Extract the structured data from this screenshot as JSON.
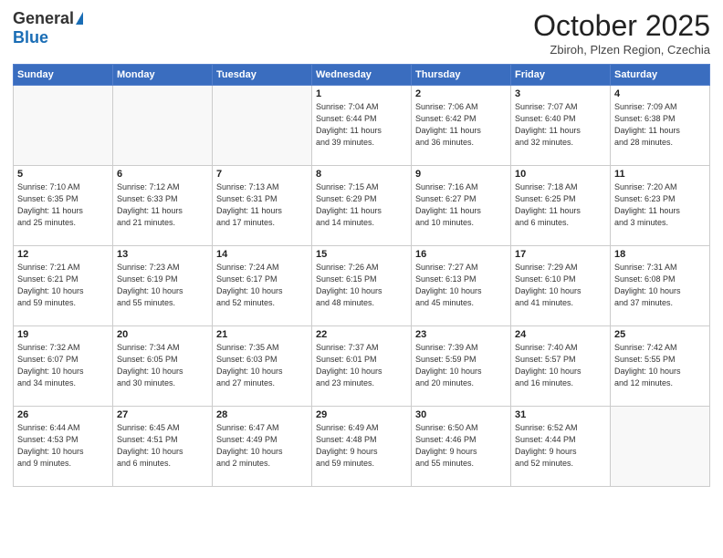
{
  "logo": {
    "general": "General",
    "blue": "Blue"
  },
  "header": {
    "month": "October 2025",
    "location": "Zbiroh, Plzen Region, Czechia"
  },
  "weekdays": [
    "Sunday",
    "Monday",
    "Tuesday",
    "Wednesday",
    "Thursday",
    "Friday",
    "Saturday"
  ],
  "weeks": [
    [
      {
        "day": "",
        "info": ""
      },
      {
        "day": "",
        "info": ""
      },
      {
        "day": "",
        "info": ""
      },
      {
        "day": "1",
        "info": "Sunrise: 7:04 AM\nSunset: 6:44 PM\nDaylight: 11 hours\nand 39 minutes."
      },
      {
        "day": "2",
        "info": "Sunrise: 7:06 AM\nSunset: 6:42 PM\nDaylight: 11 hours\nand 36 minutes."
      },
      {
        "day": "3",
        "info": "Sunrise: 7:07 AM\nSunset: 6:40 PM\nDaylight: 11 hours\nand 32 minutes."
      },
      {
        "day": "4",
        "info": "Sunrise: 7:09 AM\nSunset: 6:38 PM\nDaylight: 11 hours\nand 28 minutes."
      }
    ],
    [
      {
        "day": "5",
        "info": "Sunrise: 7:10 AM\nSunset: 6:35 PM\nDaylight: 11 hours\nand 25 minutes."
      },
      {
        "day": "6",
        "info": "Sunrise: 7:12 AM\nSunset: 6:33 PM\nDaylight: 11 hours\nand 21 minutes."
      },
      {
        "day": "7",
        "info": "Sunrise: 7:13 AM\nSunset: 6:31 PM\nDaylight: 11 hours\nand 17 minutes."
      },
      {
        "day": "8",
        "info": "Sunrise: 7:15 AM\nSunset: 6:29 PM\nDaylight: 11 hours\nand 14 minutes."
      },
      {
        "day": "9",
        "info": "Sunrise: 7:16 AM\nSunset: 6:27 PM\nDaylight: 11 hours\nand 10 minutes."
      },
      {
        "day": "10",
        "info": "Sunrise: 7:18 AM\nSunset: 6:25 PM\nDaylight: 11 hours\nand 6 minutes."
      },
      {
        "day": "11",
        "info": "Sunrise: 7:20 AM\nSunset: 6:23 PM\nDaylight: 11 hours\nand 3 minutes."
      }
    ],
    [
      {
        "day": "12",
        "info": "Sunrise: 7:21 AM\nSunset: 6:21 PM\nDaylight: 10 hours\nand 59 minutes."
      },
      {
        "day": "13",
        "info": "Sunrise: 7:23 AM\nSunset: 6:19 PM\nDaylight: 10 hours\nand 55 minutes."
      },
      {
        "day": "14",
        "info": "Sunrise: 7:24 AM\nSunset: 6:17 PM\nDaylight: 10 hours\nand 52 minutes."
      },
      {
        "day": "15",
        "info": "Sunrise: 7:26 AM\nSunset: 6:15 PM\nDaylight: 10 hours\nand 48 minutes."
      },
      {
        "day": "16",
        "info": "Sunrise: 7:27 AM\nSunset: 6:13 PM\nDaylight: 10 hours\nand 45 minutes."
      },
      {
        "day": "17",
        "info": "Sunrise: 7:29 AM\nSunset: 6:10 PM\nDaylight: 10 hours\nand 41 minutes."
      },
      {
        "day": "18",
        "info": "Sunrise: 7:31 AM\nSunset: 6:08 PM\nDaylight: 10 hours\nand 37 minutes."
      }
    ],
    [
      {
        "day": "19",
        "info": "Sunrise: 7:32 AM\nSunset: 6:07 PM\nDaylight: 10 hours\nand 34 minutes."
      },
      {
        "day": "20",
        "info": "Sunrise: 7:34 AM\nSunset: 6:05 PM\nDaylight: 10 hours\nand 30 minutes."
      },
      {
        "day": "21",
        "info": "Sunrise: 7:35 AM\nSunset: 6:03 PM\nDaylight: 10 hours\nand 27 minutes."
      },
      {
        "day": "22",
        "info": "Sunrise: 7:37 AM\nSunset: 6:01 PM\nDaylight: 10 hours\nand 23 minutes."
      },
      {
        "day": "23",
        "info": "Sunrise: 7:39 AM\nSunset: 5:59 PM\nDaylight: 10 hours\nand 20 minutes."
      },
      {
        "day": "24",
        "info": "Sunrise: 7:40 AM\nSunset: 5:57 PM\nDaylight: 10 hours\nand 16 minutes."
      },
      {
        "day": "25",
        "info": "Sunrise: 7:42 AM\nSunset: 5:55 PM\nDaylight: 10 hours\nand 12 minutes."
      }
    ],
    [
      {
        "day": "26",
        "info": "Sunrise: 6:44 AM\nSunset: 4:53 PM\nDaylight: 10 hours\nand 9 minutes."
      },
      {
        "day": "27",
        "info": "Sunrise: 6:45 AM\nSunset: 4:51 PM\nDaylight: 10 hours\nand 6 minutes."
      },
      {
        "day": "28",
        "info": "Sunrise: 6:47 AM\nSunset: 4:49 PM\nDaylight: 10 hours\nand 2 minutes."
      },
      {
        "day": "29",
        "info": "Sunrise: 6:49 AM\nSunset: 4:48 PM\nDaylight: 9 hours\nand 59 minutes."
      },
      {
        "day": "30",
        "info": "Sunrise: 6:50 AM\nSunset: 4:46 PM\nDaylight: 9 hours\nand 55 minutes."
      },
      {
        "day": "31",
        "info": "Sunrise: 6:52 AM\nSunset: 4:44 PM\nDaylight: 9 hours\nand 52 minutes."
      },
      {
        "day": "",
        "info": ""
      }
    ]
  ]
}
